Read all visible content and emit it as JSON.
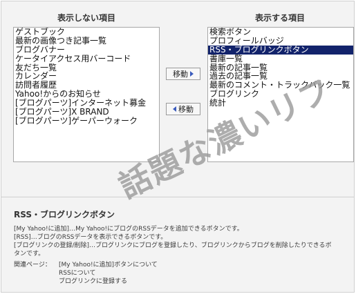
{
  "left_column": {
    "title": "表示しない項目",
    "items": [
      "ゲストブック",
      "最新の画像つき記事一覧",
      "ブログバナー",
      "ケータイアクセス用バーコード",
      "友だち一覧",
      "カレンダー",
      "訪問者履歴",
      "Yahoo!からのお知らせ",
      "[ブログパーツ]インターネット募金",
      "[ブログパーツ]X BRAND",
      "[ブログパーツ]ゲーパーウォーク"
    ]
  },
  "right_column": {
    "title": "表示する項目",
    "items": [
      "検索ボタン",
      "プロフィールバッジ",
      "RSS・ブログリンクボタン",
      "書庫一覧",
      "最新の記事一覧",
      "過去の記事一覧",
      "最新のコメント・トラックバック一覧",
      "ブログリンク",
      "統計"
    ],
    "selected_item": "RSS・ブログリンクボタン"
  },
  "buttons": {
    "move_right": "移動",
    "move_left": "移動"
  },
  "watermark": "話題な濃いリフ",
  "description": {
    "title": "RSS・ブログリンクボタン",
    "line1": "[My Yahoo!に追加]…My Yahoo!にブログのRSSデータを追加できるボタンです。",
    "line2": "[RSS]…ブログのRSSデータを表示できるボタンです。",
    "line3": "[ブログリンクの登録/削除]…ブログリンクにブログを登録したり、ブログリンクからブログを削除したりできるボ",
    "line4": "タンです。",
    "related_label": "関連ページ：",
    "links": [
      "[My Yahoo!に追加]ボタンについて",
      "RSSについて",
      "ブログリンクに登録する"
    ]
  },
  "colors": {
    "selected_bg": "#12236b",
    "panel_bg": "#f3f3f3",
    "arrow": "#3a5bbd"
  }
}
